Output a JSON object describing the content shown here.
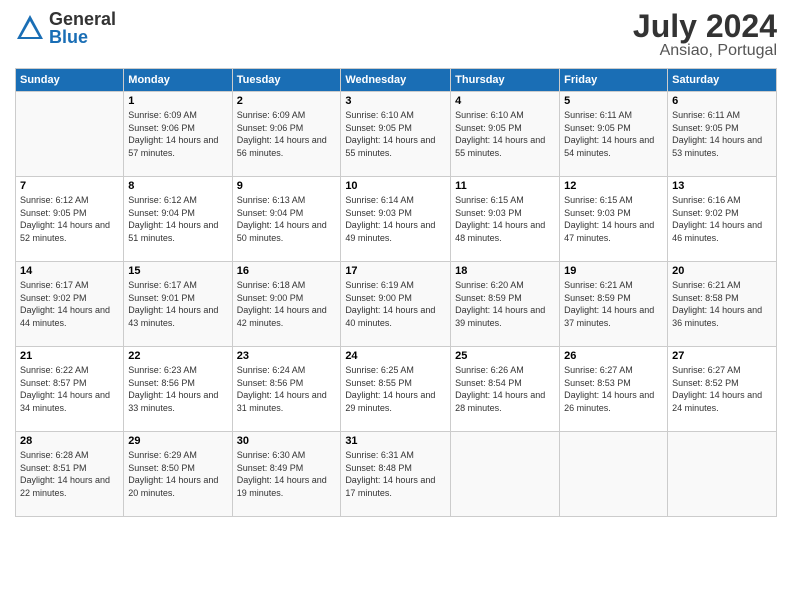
{
  "header": {
    "logo_general": "General",
    "logo_blue": "Blue",
    "month_year": "July 2024",
    "location": "Ansiao, Portugal"
  },
  "days_of_week": [
    "Sunday",
    "Monday",
    "Tuesday",
    "Wednesday",
    "Thursday",
    "Friday",
    "Saturday"
  ],
  "weeks": [
    [
      {
        "num": "",
        "sunrise": "",
        "sunset": "",
        "daylight": ""
      },
      {
        "num": "1",
        "sunrise": "6:09 AM",
        "sunset": "9:06 PM",
        "daylight": "14 hours and 57 minutes."
      },
      {
        "num": "2",
        "sunrise": "6:09 AM",
        "sunset": "9:06 PM",
        "daylight": "14 hours and 56 minutes."
      },
      {
        "num": "3",
        "sunrise": "6:10 AM",
        "sunset": "9:05 PM",
        "daylight": "14 hours and 55 minutes."
      },
      {
        "num": "4",
        "sunrise": "6:10 AM",
        "sunset": "9:05 PM",
        "daylight": "14 hours and 55 minutes."
      },
      {
        "num": "5",
        "sunrise": "6:11 AM",
        "sunset": "9:05 PM",
        "daylight": "14 hours and 54 minutes."
      },
      {
        "num": "6",
        "sunrise": "6:11 AM",
        "sunset": "9:05 PM",
        "daylight": "14 hours and 53 minutes."
      }
    ],
    [
      {
        "num": "7",
        "sunrise": "6:12 AM",
        "sunset": "9:05 PM",
        "daylight": "14 hours and 52 minutes."
      },
      {
        "num": "8",
        "sunrise": "6:12 AM",
        "sunset": "9:04 PM",
        "daylight": "14 hours and 51 minutes."
      },
      {
        "num": "9",
        "sunrise": "6:13 AM",
        "sunset": "9:04 PM",
        "daylight": "14 hours and 50 minutes."
      },
      {
        "num": "10",
        "sunrise": "6:14 AM",
        "sunset": "9:03 PM",
        "daylight": "14 hours and 49 minutes."
      },
      {
        "num": "11",
        "sunrise": "6:15 AM",
        "sunset": "9:03 PM",
        "daylight": "14 hours and 48 minutes."
      },
      {
        "num": "12",
        "sunrise": "6:15 AM",
        "sunset": "9:03 PM",
        "daylight": "14 hours and 47 minutes."
      },
      {
        "num": "13",
        "sunrise": "6:16 AM",
        "sunset": "9:02 PM",
        "daylight": "14 hours and 46 minutes."
      }
    ],
    [
      {
        "num": "14",
        "sunrise": "6:17 AM",
        "sunset": "9:02 PM",
        "daylight": "14 hours and 44 minutes."
      },
      {
        "num": "15",
        "sunrise": "6:17 AM",
        "sunset": "9:01 PM",
        "daylight": "14 hours and 43 minutes."
      },
      {
        "num": "16",
        "sunrise": "6:18 AM",
        "sunset": "9:00 PM",
        "daylight": "14 hours and 42 minutes."
      },
      {
        "num": "17",
        "sunrise": "6:19 AM",
        "sunset": "9:00 PM",
        "daylight": "14 hours and 40 minutes."
      },
      {
        "num": "18",
        "sunrise": "6:20 AM",
        "sunset": "8:59 PM",
        "daylight": "14 hours and 39 minutes."
      },
      {
        "num": "19",
        "sunrise": "6:21 AM",
        "sunset": "8:59 PM",
        "daylight": "14 hours and 37 minutes."
      },
      {
        "num": "20",
        "sunrise": "6:21 AM",
        "sunset": "8:58 PM",
        "daylight": "14 hours and 36 minutes."
      }
    ],
    [
      {
        "num": "21",
        "sunrise": "6:22 AM",
        "sunset": "8:57 PM",
        "daylight": "14 hours and 34 minutes."
      },
      {
        "num": "22",
        "sunrise": "6:23 AM",
        "sunset": "8:56 PM",
        "daylight": "14 hours and 33 minutes."
      },
      {
        "num": "23",
        "sunrise": "6:24 AM",
        "sunset": "8:56 PM",
        "daylight": "14 hours and 31 minutes."
      },
      {
        "num": "24",
        "sunrise": "6:25 AM",
        "sunset": "8:55 PM",
        "daylight": "14 hours and 29 minutes."
      },
      {
        "num": "25",
        "sunrise": "6:26 AM",
        "sunset": "8:54 PM",
        "daylight": "14 hours and 28 minutes."
      },
      {
        "num": "26",
        "sunrise": "6:27 AM",
        "sunset": "8:53 PM",
        "daylight": "14 hours and 26 minutes."
      },
      {
        "num": "27",
        "sunrise": "6:27 AM",
        "sunset": "8:52 PM",
        "daylight": "14 hours and 24 minutes."
      }
    ],
    [
      {
        "num": "28",
        "sunrise": "6:28 AM",
        "sunset": "8:51 PM",
        "daylight": "14 hours and 22 minutes."
      },
      {
        "num": "29",
        "sunrise": "6:29 AM",
        "sunset": "8:50 PM",
        "daylight": "14 hours and 20 minutes."
      },
      {
        "num": "30",
        "sunrise": "6:30 AM",
        "sunset": "8:49 PM",
        "daylight": "14 hours and 19 minutes."
      },
      {
        "num": "31",
        "sunrise": "6:31 AM",
        "sunset": "8:48 PM",
        "daylight": "14 hours and 17 minutes."
      },
      {
        "num": "",
        "sunrise": "",
        "sunset": "",
        "daylight": ""
      },
      {
        "num": "",
        "sunrise": "",
        "sunset": "",
        "daylight": ""
      },
      {
        "num": "",
        "sunrise": "",
        "sunset": "",
        "daylight": ""
      }
    ]
  ]
}
